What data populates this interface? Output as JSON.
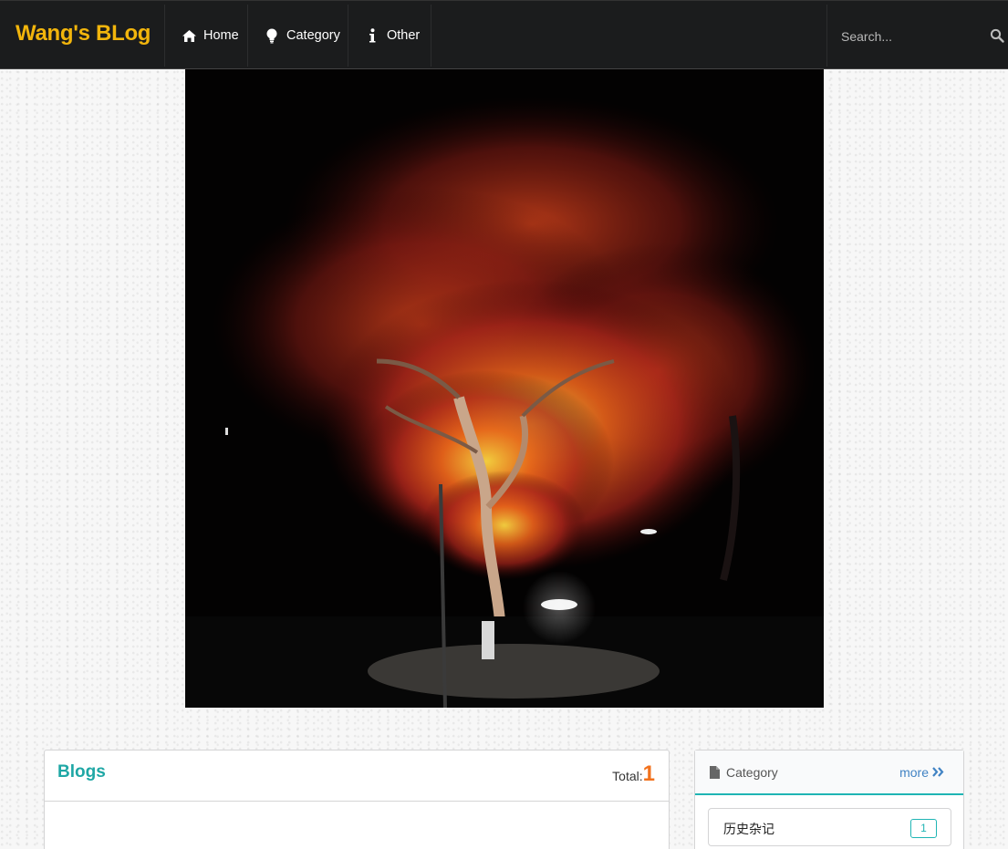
{
  "navbar": {
    "brand": "Wang's BLog",
    "items": [
      {
        "label": "Home",
        "icon": "home-icon"
      },
      {
        "label": "Category",
        "icon": "lightbulb-icon"
      },
      {
        "label": "Other",
        "icon": "info-icon"
      }
    ],
    "search_placeholder": "Search..."
  },
  "hero": {
    "subject": "red maple tree lit at night"
  },
  "blogs": {
    "title": "Blogs",
    "total_label": "Total:",
    "total_count": "1"
  },
  "category_panel": {
    "title": "Category",
    "more_label": "more",
    "items": [
      {
        "label": "历史杂记",
        "count": "1"
      }
    ]
  },
  "colors": {
    "brand": "#f2b50c",
    "teal": "#1fa7a5",
    "orange": "#f2711c",
    "link": "#4183c4",
    "navbar_bg": "#1b1c1d"
  }
}
